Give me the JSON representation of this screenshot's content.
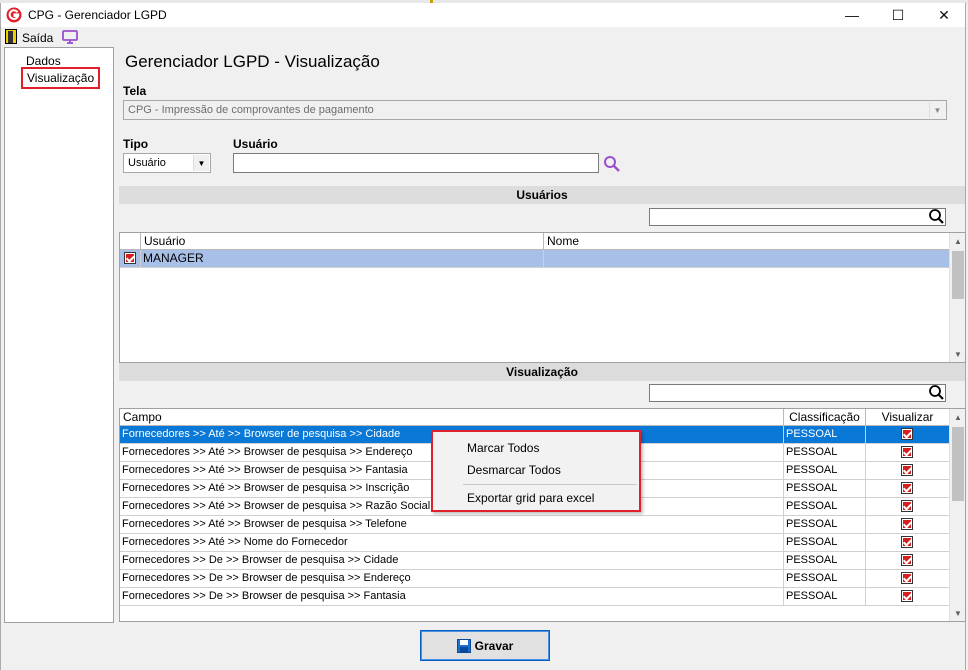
{
  "window": {
    "title": "CPG - Gerenciador LGPD",
    "minimize": "—",
    "maximize": "☐",
    "close": "✕"
  },
  "menubar": {
    "exit_label": "Saída"
  },
  "tree": {
    "items": [
      {
        "label": "Dados"
      },
      {
        "label": "Visualização"
      }
    ]
  },
  "page": {
    "title": "Gerenciador LGPD - Visualização"
  },
  "form": {
    "tela_label": "Tela",
    "tela_value": "CPG - Impressão de comprovantes de pagamento",
    "tipo_label": "Tipo",
    "tipo_value": "Usuário",
    "usuario_label": "Usuário",
    "usuario_value": ""
  },
  "users_section": {
    "title": "Usuários",
    "columns": [
      "Usuário",
      "Nome"
    ],
    "rows": [
      {
        "checked": true,
        "usuario": "MANAGER",
        "nome": ""
      }
    ]
  },
  "view_section": {
    "title": "Visualização",
    "columns": [
      "Campo",
      "Classificação",
      "Visualizar"
    ],
    "rows": [
      {
        "campo": "Fornecedores >> Até >> Browser de pesquisa >> Cidade",
        "classificacao": "PESSOAL",
        "visualizar": true
      },
      {
        "campo": "Fornecedores >> Até >> Browser de pesquisa >> Endereço",
        "classificacao": "PESSOAL",
        "visualizar": true
      },
      {
        "campo": "Fornecedores >> Até >> Browser de pesquisa >> Fantasia",
        "classificacao": "PESSOAL",
        "visualizar": true
      },
      {
        "campo": "Fornecedores >> Até >> Browser de pesquisa >> Inscrição",
        "classificacao": "PESSOAL",
        "visualizar": true
      },
      {
        "campo": "Fornecedores >> Até >> Browser de pesquisa >> Razão Social",
        "classificacao": "PESSOAL",
        "visualizar": true
      },
      {
        "campo": "Fornecedores >> Até >> Browser de pesquisa >> Telefone",
        "classificacao": "PESSOAL",
        "visualizar": true
      },
      {
        "campo": "Fornecedores >> Até >> Nome do Fornecedor",
        "classificacao": "PESSOAL",
        "visualizar": true
      },
      {
        "campo": "Fornecedores >> De >> Browser de pesquisa >> Cidade",
        "classificacao": "PESSOAL",
        "visualizar": true
      },
      {
        "campo": "Fornecedores >> De >> Browser de pesquisa >> Endereço",
        "classificacao": "PESSOAL",
        "visualizar": true
      },
      {
        "campo": "Fornecedores >> De >> Browser de pesquisa >> Fantasia",
        "classificacao": "PESSOAL",
        "visualizar": true
      }
    ]
  },
  "context_menu": {
    "items": [
      "Marcar Todos",
      "Desmarcar Todos",
      "Exportar grid para excel"
    ]
  },
  "footer": {
    "save_label": "Gravar"
  },
  "colors": {
    "selection": "#0a78d7",
    "highlight": "#e0202a",
    "check": "#d42020",
    "search": "#9b4fd0"
  }
}
